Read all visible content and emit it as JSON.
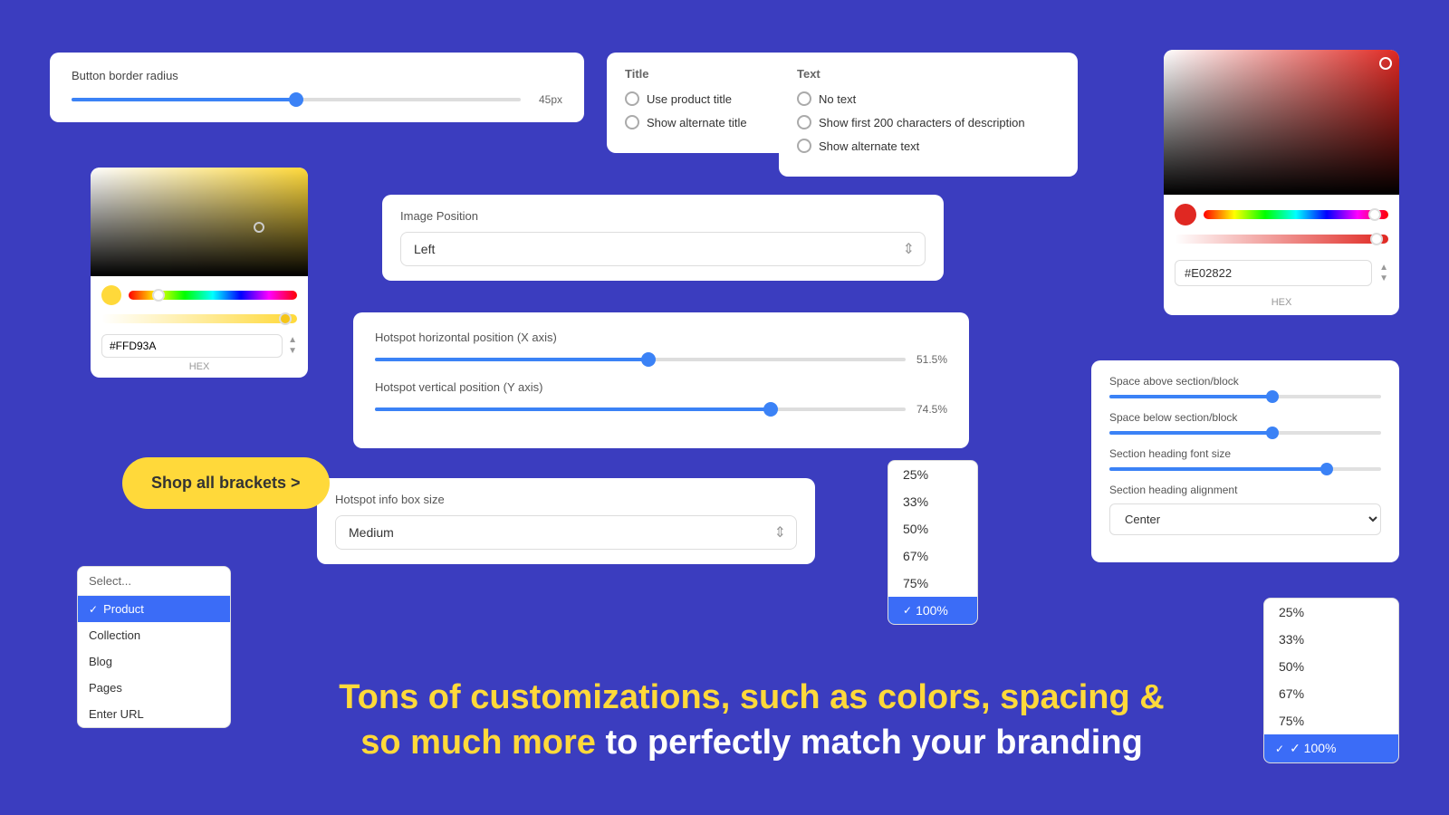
{
  "background": "#3b3dbf",
  "cards": {
    "border_radius": {
      "label": "Button border radius",
      "value": "45px",
      "fill_width": "50%",
      "thumb_left": "50%"
    },
    "title": {
      "section": "Title",
      "option1": "Use product title",
      "option2": "Show alternate title"
    },
    "text": {
      "section": "Text",
      "option1": "No text",
      "option2": "Show first 200 characters of description",
      "option3": "Show alternate text"
    },
    "color_right": {
      "hex_value": "#E02822",
      "hex_label": "HEX"
    },
    "color_yellow": {
      "hex_value": "#FFD93A",
      "hex_label": "HEX"
    },
    "image_position": {
      "label": "Image Position",
      "value": "Left"
    },
    "hotspot": {
      "x_label": "Hotspot horizontal position (X axis)",
      "x_value": "51.5%",
      "x_fill": "51.5%",
      "y_label": "Hotspot vertical position (Y axis)",
      "y_value": "74.5%",
      "y_fill": "74.5%"
    },
    "hotspot_size": {
      "label": "Hotspot info box size",
      "value": "Medium"
    },
    "spacing": {
      "label1": "Space above section/block",
      "label2": "Space below section/block",
      "label3": "Section heading font size",
      "label4": "Section heading alignment",
      "alignment_value": "Center",
      "fill1": "60%",
      "thumb1": "60%",
      "fill2": "60%",
      "thumb2": "60%",
      "fill3": "80%",
      "thumb3": "80%"
    }
  },
  "shop_button": {
    "label": "Shop all brackets >"
  },
  "dropdown": {
    "placeholder": "Select...",
    "items": [
      {
        "label": "Product",
        "active": true
      },
      {
        "label": "Collection",
        "active": false
      },
      {
        "label": "Blog",
        "active": false
      },
      {
        "label": "Pages",
        "active": false
      },
      {
        "label": "Enter URL",
        "active": false
      }
    ]
  },
  "percent_left": {
    "items": [
      {
        "label": "25%",
        "active": false
      },
      {
        "label": "33%",
        "active": false
      },
      {
        "label": "50%",
        "active": false
      },
      {
        "label": "67%",
        "active": false
      },
      {
        "label": "75%",
        "active": false
      },
      {
        "label": "100%",
        "active": true
      }
    ]
  },
  "percent_right": {
    "items": [
      {
        "label": "25%",
        "active": false
      },
      {
        "label": "33%",
        "active": false
      },
      {
        "label": "50%",
        "active": false
      },
      {
        "label": "67%",
        "active": false
      },
      {
        "label": "75%",
        "active": false
      },
      {
        "label": "100%",
        "active": true
      }
    ]
  },
  "bottom_text": {
    "line1": "Tons of customizations, such as colors, spacing &",
    "line2_highlight": "so much more",
    "line2_white": " to perfectly match your branding"
  }
}
